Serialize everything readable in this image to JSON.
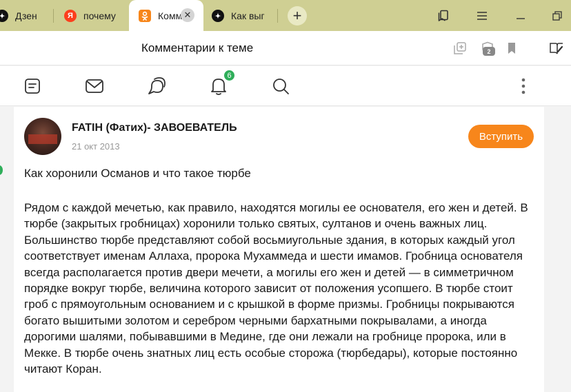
{
  "browser": {
    "tabs": [
      {
        "title": "Дзен",
        "icon": "dzen-icon",
        "color": "#111111"
      },
      {
        "title": "почему",
        "icon": "yandex-icon",
        "color": "#fc3f1d"
      },
      {
        "title": "Комментарии к теме",
        "icon": "odnoklassniki-icon",
        "color": "#f7861b",
        "active": true
      },
      {
        "title": "Как выг",
        "icon": "dzen-icon",
        "color": "#111111"
      }
    ],
    "new_tab_label": "+"
  },
  "titlebar": {
    "page_title": "Комментарии к теме",
    "badge_count": "2"
  },
  "sitenav": {
    "notifications_count": "6"
  },
  "post": {
    "author": "FATIH (Фатих)- ЗАВОЕВАТЕЛЬ",
    "date": "21 окт 2013",
    "join_label": "Вступить",
    "heading": "Как хоронили Османов и что такое тюрбе",
    "body": "Рядом с каждой мечетью, как правило, находятся могилы ее основателя, его жен и детей. В тюрбе (закрытых гробницах) хоронили только святых, султанов и очень важных лиц. Большинство тюрбе представляют собой восьмиугольные здания, в которых каждый угол соответствует именам Аллаха, пророка Мухаммеда и шести имамов. Гробница основателя всегда располагается против двери мечети, а могилы его жен и детей — в симметричном порядке вокруг тюрбе, величина которого зависит от положения усопшего. В тюрбе стоит гроб с прямоугольным основанием и с крышкой в форме призмы. Гробницы покрываются богато вышитыми золотом и серебром черными бархатными покрывалами, а иногда дорогими шалями, побывавшими в Медине, где они лежали на гробнице пророка, или в Мекке. В тюрбе очень знатных лиц есть особые сторожа (тюрбедары), которые постоянно читают Коран."
  },
  "colors": {
    "tabbar": "#cfcf93",
    "accent_orange": "#f7861b",
    "badge_green": "#2fae5a"
  }
}
